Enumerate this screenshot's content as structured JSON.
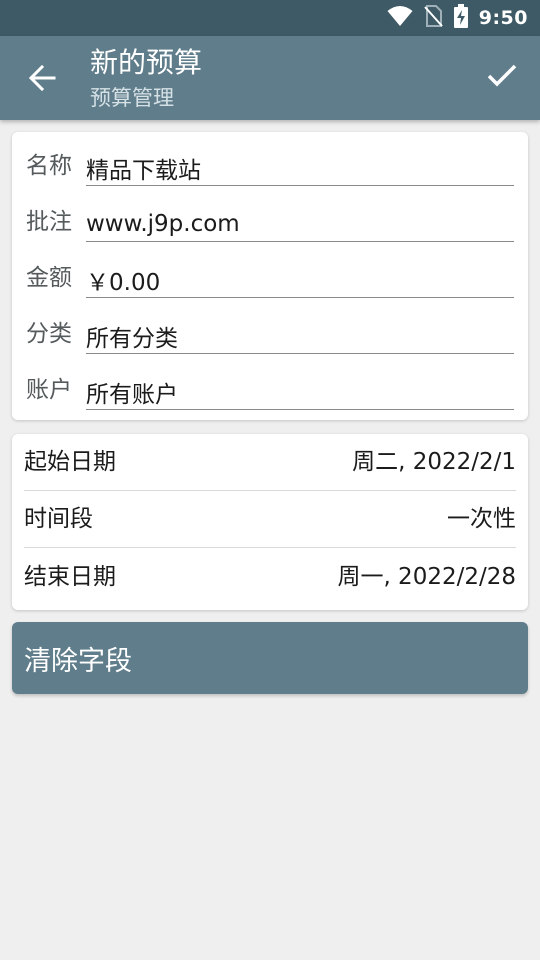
{
  "status_bar": {
    "time": "9:50",
    "icons": [
      "wifi-icon",
      "no-sim-icon",
      "battery-charging-icon"
    ]
  },
  "app_bar": {
    "title": "新的预算",
    "subtitle": "预算管理",
    "back_icon": "arrow-left-icon",
    "confirm_icon": "check-icon"
  },
  "form": {
    "name": {
      "label": "名称",
      "value": "精品下载站"
    },
    "note": {
      "label": "批注",
      "value": "www.j9p.com"
    },
    "amount": {
      "label": "金额",
      "value": "￥0.00"
    },
    "category": {
      "label": "分类",
      "value": "所有分类"
    },
    "account": {
      "label": "账户",
      "value": "所有账户"
    }
  },
  "period": {
    "start": {
      "label": "起始日期",
      "value": "周二, 2022/2/1"
    },
    "span": {
      "label": "时间段",
      "value": "一次性"
    },
    "end": {
      "label": "结束日期",
      "value": "周一, 2022/2/28"
    }
  },
  "clear_button": {
    "label": "清除字段"
  },
  "colors": {
    "status_bar": "#3e5a66",
    "app_bar": "#607d8b",
    "background": "#efefef",
    "card": "#ffffff"
  }
}
